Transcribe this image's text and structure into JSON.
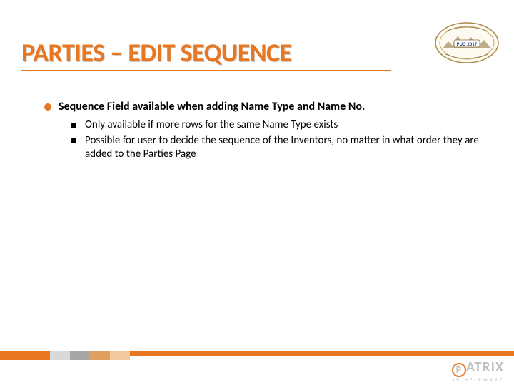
{
  "title": "PARTIES – EDIT SEQUENCE",
  "badge": {
    "label": "PUG 2017"
  },
  "main_bullet": "Sequence Field available when adding Name Type and Name No.",
  "sub_bullets": [
    "Only available if more rows for the same Name Type exists",
    "Possible for user to decide the sequence of the Inventors, no matter in what order they are added to the Parties Page"
  ],
  "footer_logo": {
    "main_after_p": "ATRIX",
    "sub": "IP HELPWARE"
  }
}
